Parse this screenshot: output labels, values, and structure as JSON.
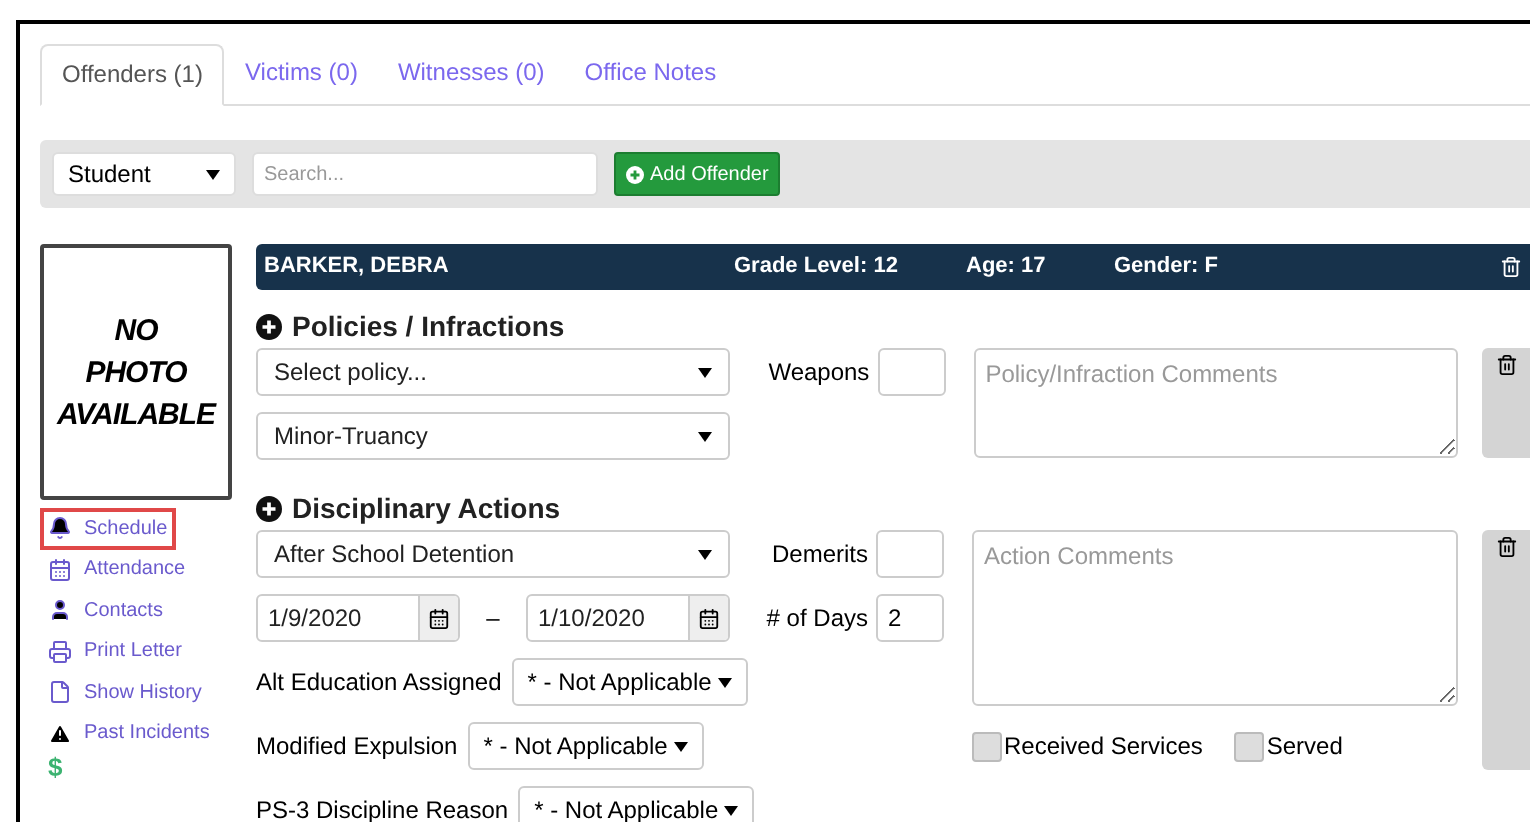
{
  "tabs": [
    {
      "label": "Offenders (1)",
      "selected": true
    },
    {
      "label": "Victims (0)",
      "selected": false
    },
    {
      "label": "Witnesses (0)",
      "selected": false
    },
    {
      "label": "Office Notes",
      "selected": false
    }
  ],
  "toolbar": {
    "type_select": "Student",
    "search": {
      "placeholder": "Search..."
    },
    "add_button": "Add Offender"
  },
  "photo": {
    "lines": [
      "NO",
      "PHOTO",
      "AVAILABLE"
    ]
  },
  "sidebar": {
    "items": [
      {
        "label": "Schedule",
        "highlighted": true
      },
      {
        "label": "Attendance",
        "highlighted": false
      },
      {
        "label": "Contacts",
        "highlighted": false
      },
      {
        "label": "Print Letter",
        "highlighted": false
      },
      {
        "label": "Show History",
        "highlighted": false
      },
      {
        "label": "Past Incidents",
        "highlighted": false
      }
    ],
    "dollar": "$"
  },
  "student": {
    "name": "BARKER, DEBRA",
    "grade": "Grade Level: 12",
    "age": "Age: 17",
    "gender": "Gender: F"
  },
  "policies": {
    "title": "Policies / Infractions",
    "selects": [
      "Select policy...",
      "Minor-Truancy"
    ],
    "weapons_label": "Weapons",
    "comments": {
      "placeholder": "Policy/Infraction Comments"
    }
  },
  "actions": {
    "title": "Disciplinary Actions",
    "action_select": "After School Detention",
    "start_date": "1/9/2020",
    "date_dash": "–",
    "end_date": "1/10/2020",
    "fields": [
      {
        "label": "Alt Education Assigned",
        "value": "* - Not Applicable"
      },
      {
        "label": "Modified Expulsion",
        "value": "* - Not Applicable"
      },
      {
        "label": "PS-3 Discipline Reason",
        "value": "* - Not Applicable"
      }
    ],
    "demerits_label": "Demerits",
    "days_label": "# of Days",
    "days_value": "2",
    "comments": {
      "placeholder": "Action Comments"
    },
    "checkboxes": [
      {
        "label": "Received Services",
        "checked": false
      },
      {
        "label": "Served",
        "checked": false
      }
    ]
  }
}
